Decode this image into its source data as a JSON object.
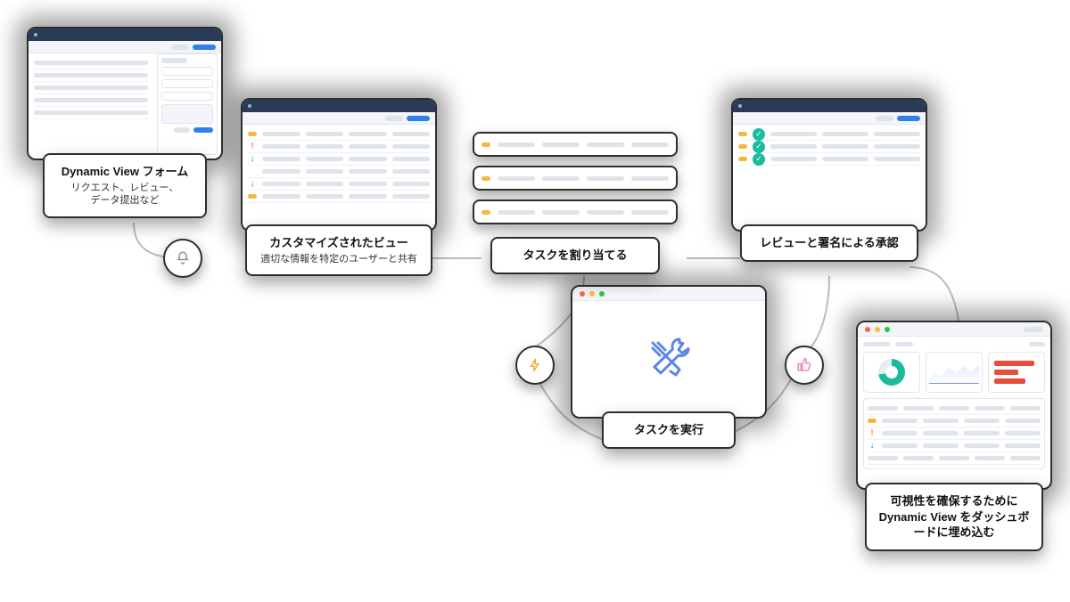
{
  "nodes": {
    "form": {
      "title": "Dynamic View フォーム",
      "subtitle": "リクエスト、レビュー、\nデータ提出など"
    },
    "custom": {
      "title": "カスタマイズされたビュー",
      "subtitle": "適切な情報を特定のユーザーと共有"
    },
    "assign": {
      "title": "タスクを割り当てる"
    },
    "approve": {
      "title": "レビューと署名による承認"
    },
    "perform": {
      "title": "タスクを実行"
    },
    "dashboard": {
      "title": "可視性を確保するために Dynamic View をダッシュボードに埋め込む"
    }
  },
  "badges": {
    "bell": {
      "icon": "bell-icon",
      "color": "#8a93a0"
    },
    "bolt": {
      "icon": "bolt-icon",
      "color": "#f5a623"
    },
    "thumb": {
      "icon": "thumb-icon",
      "color": "#e98bbf"
    }
  },
  "colors": {
    "frame": "#2e2e2e",
    "header": "#2a3b57",
    "accentBlue": "#2f80ed",
    "accentGreen": "#1abc9c",
    "accentAmber": "#f5b642"
  }
}
